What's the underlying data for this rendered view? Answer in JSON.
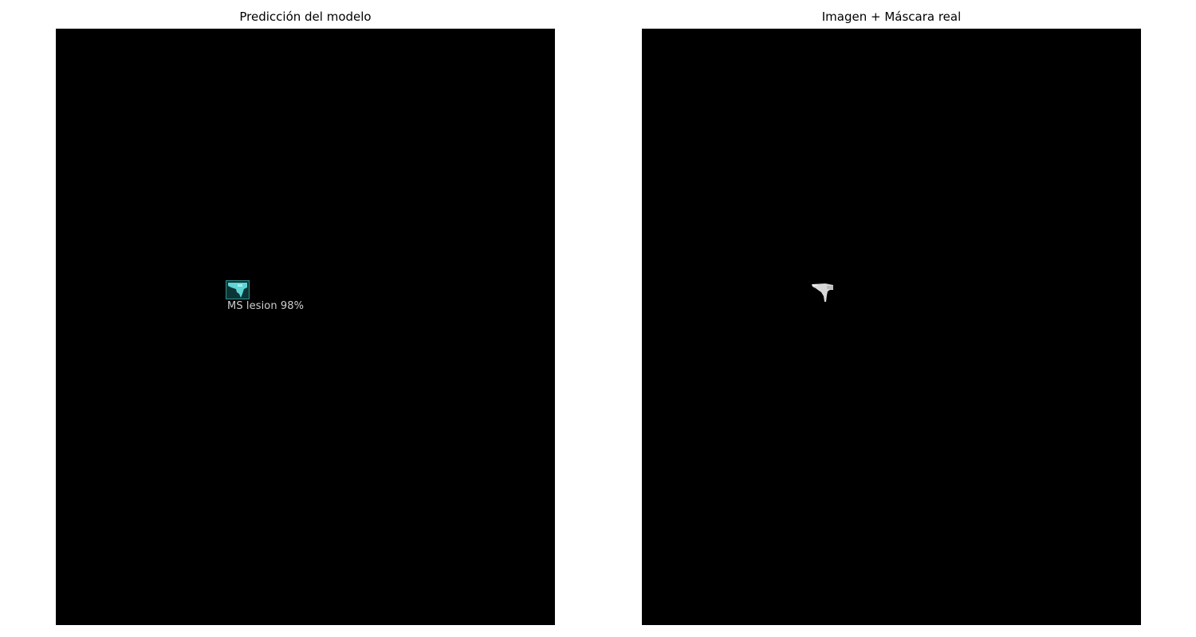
{
  "figure": {
    "left_panel": {
      "title": "Predicción del modelo",
      "detection": {
        "label": "MS lesion 98%",
        "box_color": "#2f8f8f",
        "fill_color": "#5fd4d4"
      }
    },
    "right_panel": {
      "title": "Imagen + Máscara real",
      "mask_color": "#d9d9d9"
    },
    "background_color": "#000000"
  }
}
